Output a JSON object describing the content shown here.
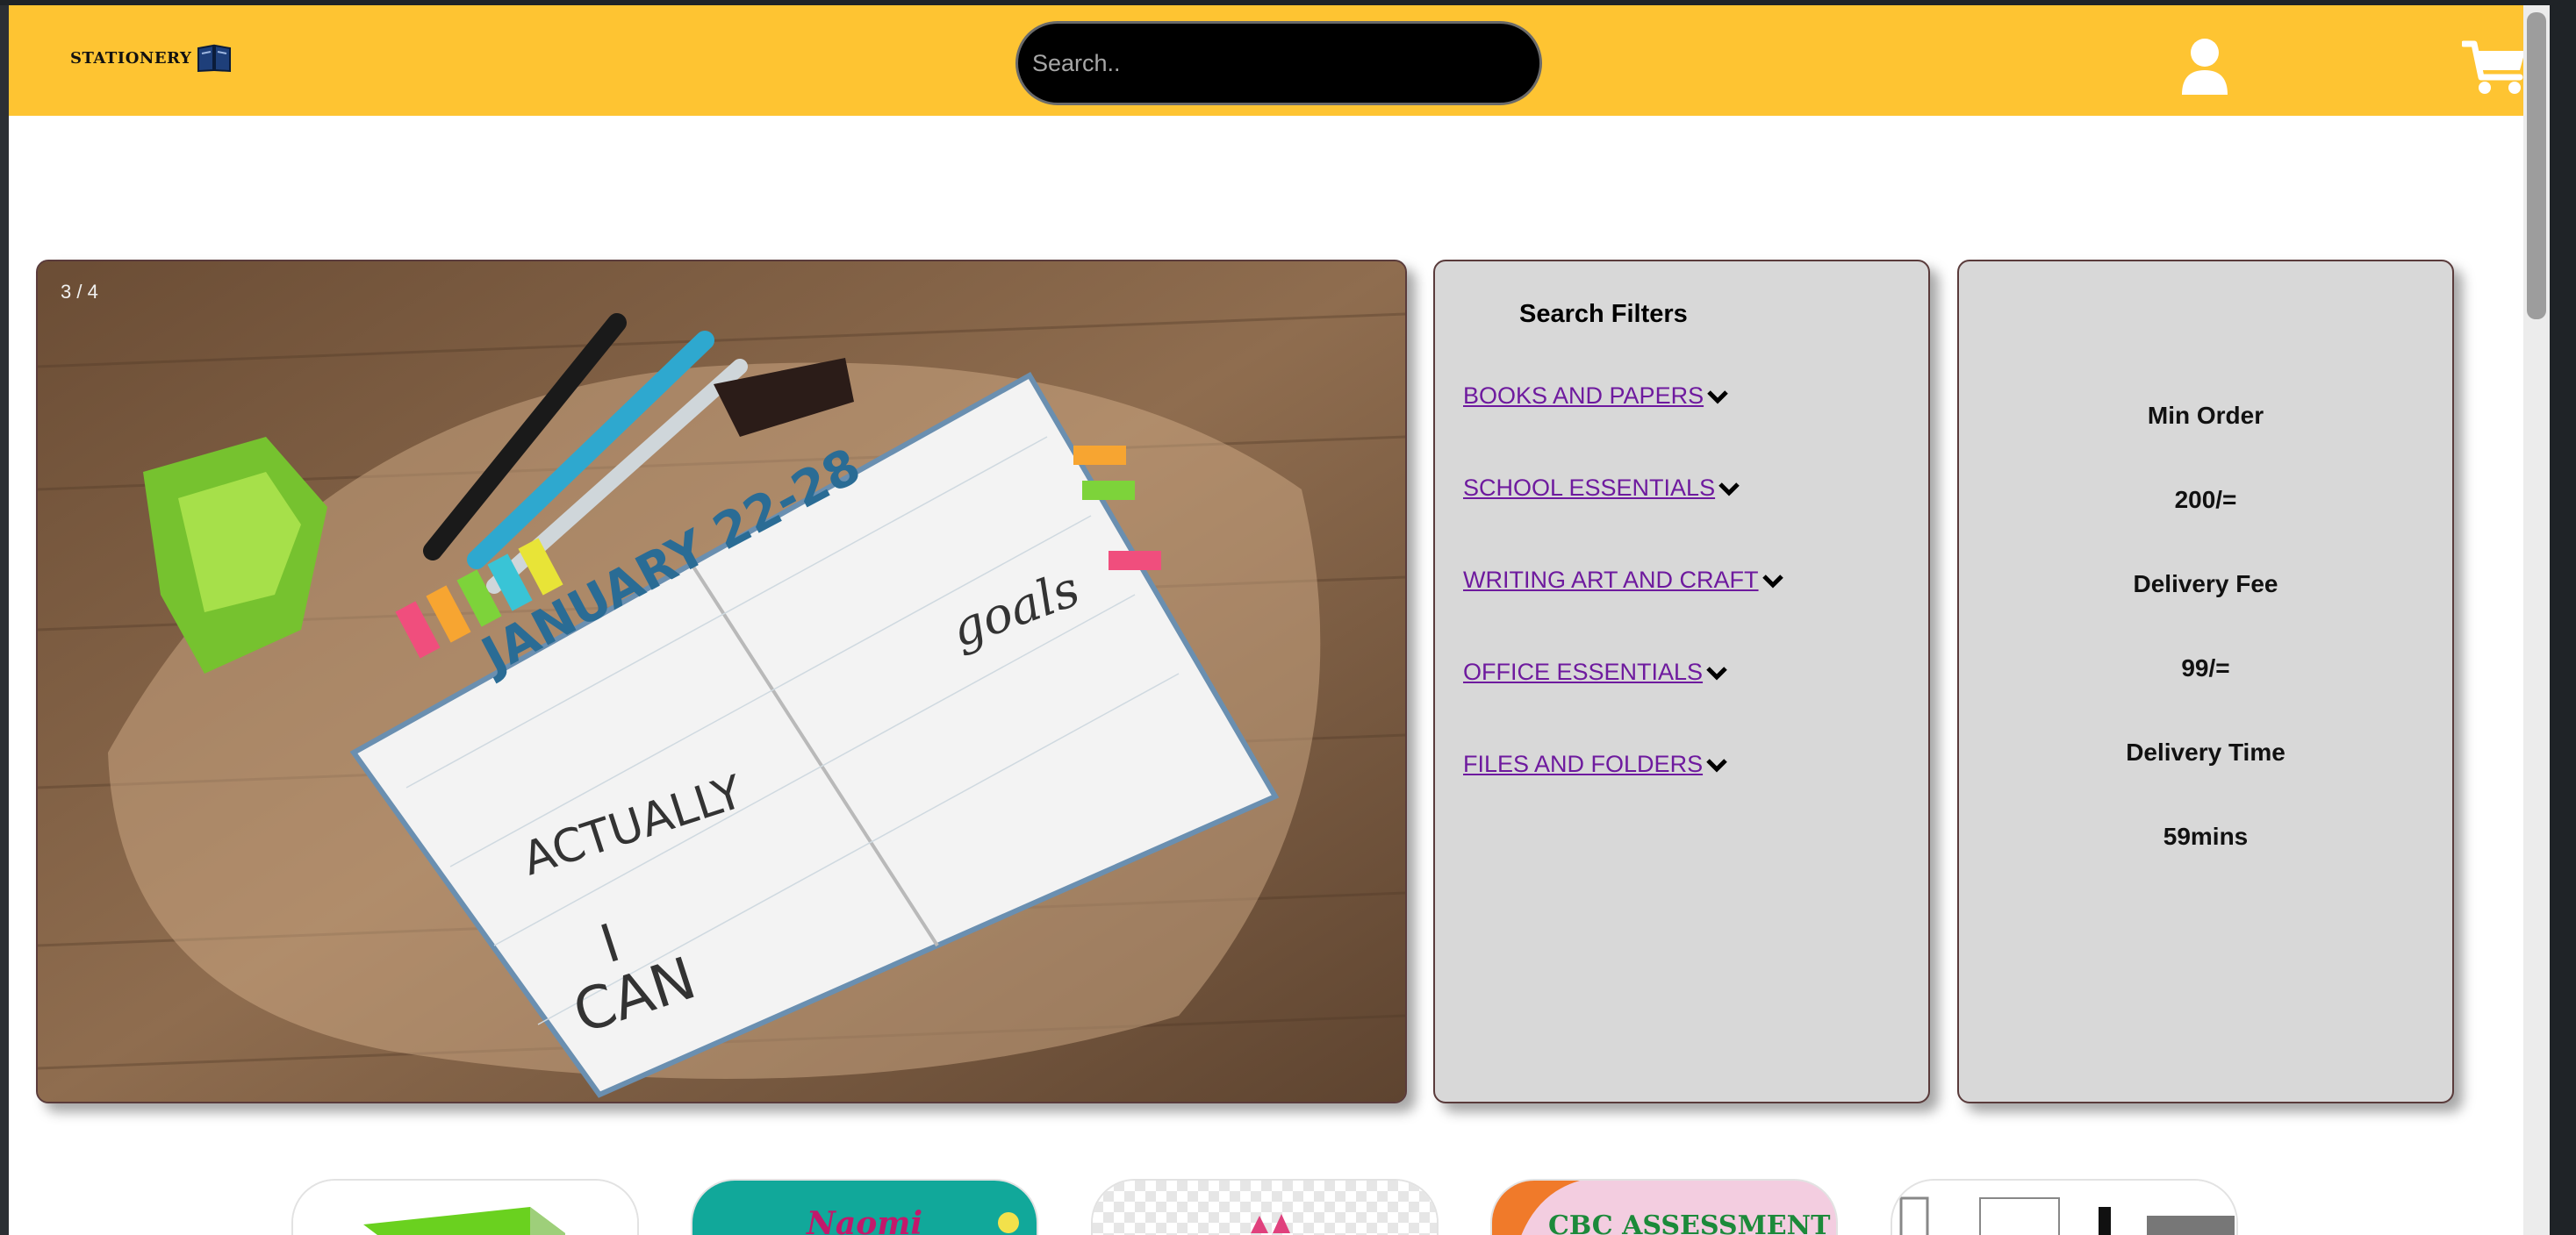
{
  "header": {
    "logo_text": "STATIONERY",
    "search_placeholder": "Search.."
  },
  "slideshow": {
    "counter": "3 / 4"
  },
  "filters": {
    "title": "Search Filters",
    "items": [
      {
        "label": "BOOKS AND PAPERS "
      },
      {
        "label": "SCHOOL ESSENTIALS "
      },
      {
        "label": "WRITING ART AND CRAFT"
      },
      {
        "label": "OFFICE ESSENTIALS "
      },
      {
        "label": "FILES AND FOLDERS "
      }
    ]
  },
  "info": {
    "min_order_label": "Min Order",
    "min_order_value": "200/=",
    "delivery_fee_label": "Delivery Fee",
    "delivery_fee_value": "99/=",
    "delivery_time_label": "Delivery Time",
    "delivery_time_value": "59mins"
  },
  "categories": [
    {
      "name": "books-card",
      "banner": ""
    },
    {
      "name": "naomi-card",
      "banner": "Naomi"
    },
    {
      "name": "art-card",
      "banner": ""
    },
    {
      "name": "cbc-assessment-card",
      "banner": "CBC ASSESSMENT"
    },
    {
      "name": "office-card",
      "banner": ""
    }
  ],
  "colors": {
    "header_bg": "#fec432",
    "panel_bg": "#d8d8d8",
    "link": "#6e1a9e"
  }
}
